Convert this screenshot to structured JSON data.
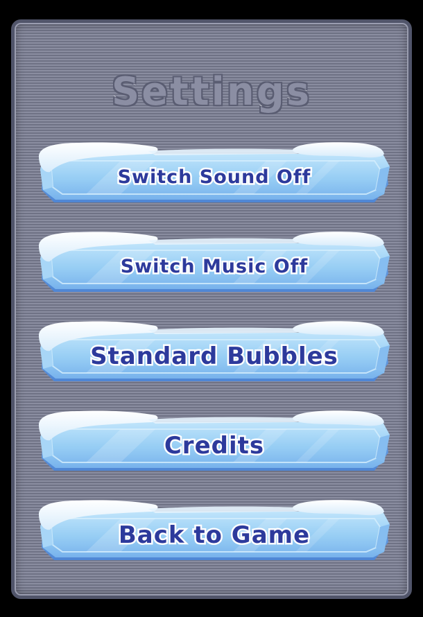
{
  "screen": {
    "title": "Settings"
  },
  "menu": {
    "buttons": [
      {
        "label": "Switch Sound Off"
      },
      {
        "label": "Switch Music Off"
      },
      {
        "label": "Standard Bubbles"
      },
      {
        "label": "Credits"
      },
      {
        "label": "Back to Game"
      }
    ]
  },
  "colors": {
    "background": "#000000",
    "panel": "#838699",
    "panel_border": "#51556a",
    "ice_light": "#bfe4fb",
    "ice_mid": "#8ec8f2",
    "ice_dark": "#5f98de",
    "snow": "#f3f9ff",
    "label_text": "#2d3a9c"
  }
}
